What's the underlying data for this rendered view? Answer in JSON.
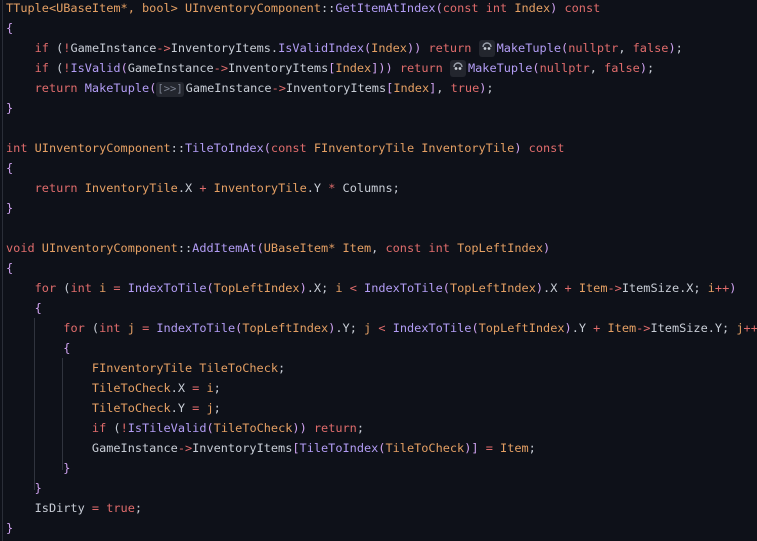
{
  "editor": {
    "language": "C++",
    "hint_icon": "copilot-icon",
    "lines": [
      [
        [
          "ty",
          "TTuple<UBaseItem*, bool> "
        ],
        [
          "ty",
          "UInventoryComponent"
        ],
        [
          "pl",
          "::"
        ],
        [
          "fn",
          "GetItemAtIndex"
        ],
        [
          "br",
          "("
        ],
        [
          "kw",
          "const int "
        ],
        [
          "ty",
          "Index"
        ],
        [
          "br",
          ")"
        ],
        [
          "kw",
          " const"
        ]
      ],
      [
        [
          "br",
          "{"
        ]
      ],
      [
        [
          "pl",
          "    "
        ],
        [
          "kw",
          "if"
        ],
        [
          "pl",
          " ("
        ],
        [
          "kw",
          "!"
        ],
        [
          "pl",
          "GameInstance"
        ],
        [
          "op",
          "->"
        ],
        [
          "pl",
          "InventoryItems."
        ],
        [
          "fn",
          "IsValidIndex"
        ],
        [
          "br",
          "("
        ],
        [
          "ty",
          "Index"
        ],
        [
          "br",
          "))"
        ],
        [
          "kw",
          " return "
        ],
        [
          "hint",
          "icon"
        ],
        [
          "fn",
          "MakeTuple"
        ],
        [
          "br",
          "("
        ],
        [
          "kw",
          "nullptr"
        ],
        [
          "pl",
          ", "
        ],
        [
          "kw",
          "false"
        ],
        [
          "br",
          ")"
        ],
        [
          "pl",
          ";"
        ]
      ],
      [
        [
          "pl",
          "    "
        ],
        [
          "kw",
          "if"
        ],
        [
          "pl",
          " ("
        ],
        [
          "kw",
          "!"
        ],
        [
          "fn",
          "IsValid"
        ],
        [
          "br",
          "("
        ],
        [
          "pl",
          "GameInstance"
        ],
        [
          "op",
          "->"
        ],
        [
          "pl",
          "InventoryItems"
        ],
        [
          "br",
          "["
        ],
        [
          "ty",
          "Index"
        ],
        [
          "br",
          "]))"
        ],
        [
          "kw",
          " return "
        ],
        [
          "hint",
          "icon"
        ],
        [
          "fn",
          "MakeTuple"
        ],
        [
          "br",
          "("
        ],
        [
          "kw",
          "nullptr"
        ],
        [
          "pl",
          ", "
        ],
        [
          "kw",
          "false"
        ],
        [
          "br",
          ")"
        ],
        [
          "pl",
          ";"
        ]
      ],
      [
        [
          "pl",
          "    "
        ],
        [
          "kw",
          "return "
        ],
        [
          "fn",
          "MakeTuple"
        ],
        [
          "br",
          "("
        ],
        [
          "hint",
          "[>>]"
        ],
        [
          "pl",
          "GameInstance"
        ],
        [
          "op",
          "->"
        ],
        [
          "pl",
          "InventoryItems"
        ],
        [
          "br",
          "["
        ],
        [
          "ty",
          "Index"
        ],
        [
          "br",
          "]"
        ],
        [
          "pl",
          ", "
        ],
        [
          "kw",
          "true"
        ],
        [
          "br",
          ")"
        ],
        [
          "pl",
          ";"
        ]
      ],
      [
        [
          "br",
          "}"
        ]
      ],
      [],
      [
        [
          "kw",
          "int "
        ],
        [
          "ty",
          "UInventoryComponent"
        ],
        [
          "pl",
          "::"
        ],
        [
          "fn",
          "TileToIndex"
        ],
        [
          "br",
          "("
        ],
        [
          "kw",
          "const "
        ],
        [
          "ty",
          "FInventoryTile InventoryTile"
        ],
        [
          "br",
          ")"
        ],
        [
          "kw",
          " const"
        ]
      ],
      [
        [
          "br",
          "{"
        ]
      ],
      [
        [
          "pl",
          "    "
        ],
        [
          "kw",
          "return "
        ],
        [
          "ty",
          "InventoryTile"
        ],
        [
          "pl",
          ".X "
        ],
        [
          "op",
          "+"
        ],
        [
          "ty",
          " InventoryTile"
        ],
        [
          "pl",
          ".Y "
        ],
        [
          "op",
          "*"
        ],
        [
          "pl",
          " Columns;"
        ]
      ],
      [
        [
          "br",
          "}"
        ]
      ],
      [],
      [
        [
          "kw",
          "void "
        ],
        [
          "ty",
          "UInventoryComponent"
        ],
        [
          "pl",
          "::"
        ],
        [
          "fn",
          "AddItemAt"
        ],
        [
          "br",
          "("
        ],
        [
          "ty",
          "UBaseItem* Item"
        ],
        [
          "pl",
          ", "
        ],
        [
          "kw",
          "const int "
        ],
        [
          "ty",
          "TopLeftIndex"
        ],
        [
          "br",
          ")"
        ]
      ],
      [
        [
          "br",
          "{"
        ]
      ],
      [
        [
          "pl",
          "    "
        ],
        [
          "kw",
          "for"
        ],
        [
          "pl",
          " ("
        ],
        [
          "kw",
          "int "
        ],
        [
          "ty",
          "i"
        ],
        [
          "op",
          " = "
        ],
        [
          "fn",
          "IndexToTile"
        ],
        [
          "br",
          "("
        ],
        [
          "ty",
          "TopLeftIndex"
        ],
        [
          "br",
          ")"
        ],
        [
          "pl",
          ".X; "
        ],
        [
          "ty",
          "i"
        ],
        [
          "op",
          " < "
        ],
        [
          "fn",
          "IndexToTile"
        ],
        [
          "br",
          "("
        ],
        [
          "ty",
          "TopLeftIndex"
        ],
        [
          "br",
          ")"
        ],
        [
          "pl",
          ".X "
        ],
        [
          "op",
          "+"
        ],
        [
          "ty",
          " Item"
        ],
        [
          "op",
          "->"
        ],
        [
          "pl",
          "ItemSize.X; "
        ],
        [
          "ty",
          "i"
        ],
        [
          "op",
          "++"
        ],
        [
          "br",
          ")"
        ]
      ],
      [
        [
          "pl",
          "    "
        ],
        [
          "br",
          "{"
        ]
      ],
      [
        [
          "pl",
          "        "
        ],
        [
          "kw",
          "for"
        ],
        [
          "pl",
          " ("
        ],
        [
          "kw",
          "int "
        ],
        [
          "ty",
          "j"
        ],
        [
          "op",
          " = "
        ],
        [
          "fn",
          "IndexToTile"
        ],
        [
          "br",
          "("
        ],
        [
          "ty",
          "TopLeftIndex"
        ],
        [
          "br",
          ")"
        ],
        [
          "pl",
          ".Y; "
        ],
        [
          "ty",
          "j"
        ],
        [
          "op",
          " < "
        ],
        [
          "fn",
          "IndexToTile"
        ],
        [
          "br",
          "("
        ],
        [
          "ty",
          "TopLeftIndex"
        ],
        [
          "br",
          ")"
        ],
        [
          "pl",
          ".Y "
        ],
        [
          "op",
          "+"
        ],
        [
          "ty",
          " Item"
        ],
        [
          "op",
          "->"
        ],
        [
          "pl",
          "ItemSize.Y; "
        ],
        [
          "ty",
          "j"
        ],
        [
          "op",
          "++"
        ],
        [
          "br",
          ")"
        ]
      ],
      [
        [
          "pl",
          "        "
        ],
        [
          "br",
          "{"
        ]
      ],
      [
        [
          "pl",
          "            "
        ],
        [
          "ty",
          "FInventoryTile TileToCheck"
        ],
        [
          "pl",
          ";"
        ]
      ],
      [
        [
          "pl",
          "            "
        ],
        [
          "ty",
          "TileToCheck"
        ],
        [
          "pl",
          ".X "
        ],
        [
          "op",
          "="
        ],
        [
          "ty",
          " i"
        ],
        [
          "pl",
          ";"
        ]
      ],
      [
        [
          "pl",
          "            "
        ],
        [
          "ty",
          "TileToCheck"
        ],
        [
          "pl",
          ".Y "
        ],
        [
          "op",
          "="
        ],
        [
          "ty",
          " j"
        ],
        [
          "pl",
          ";"
        ]
      ],
      [
        [
          "pl",
          "            "
        ],
        [
          "kw",
          "if"
        ],
        [
          "pl",
          " ("
        ],
        [
          "kw",
          "!"
        ],
        [
          "fn",
          "IsTileValid"
        ],
        [
          "br",
          "("
        ],
        [
          "ty",
          "TileToCheck"
        ],
        [
          "br",
          "))"
        ],
        [
          "kw",
          " return"
        ],
        [
          "pl",
          ";"
        ]
      ],
      [
        [
          "pl",
          "            GameInstance"
        ],
        [
          "op",
          "->"
        ],
        [
          "pl",
          "InventoryItems"
        ],
        [
          "br",
          "["
        ],
        [
          "fn",
          "TileToIndex"
        ],
        [
          "br",
          "("
        ],
        [
          "ty",
          "TileToCheck"
        ],
        [
          "br",
          ")]"
        ],
        [
          "op",
          " = "
        ],
        [
          "ty",
          "Item"
        ],
        [
          "pl",
          ";"
        ]
      ],
      [
        [
          "pl",
          "        "
        ],
        [
          "br",
          "}"
        ]
      ],
      [
        [
          "pl",
          "    "
        ],
        [
          "br",
          "}"
        ]
      ],
      [
        [
          "pl",
          "    IsDirty "
        ],
        [
          "op",
          "="
        ],
        [
          "kw",
          " true"
        ],
        [
          "pl",
          ";"
        ]
      ],
      [
        [
          "br",
          "}"
        ]
      ]
    ]
  }
}
